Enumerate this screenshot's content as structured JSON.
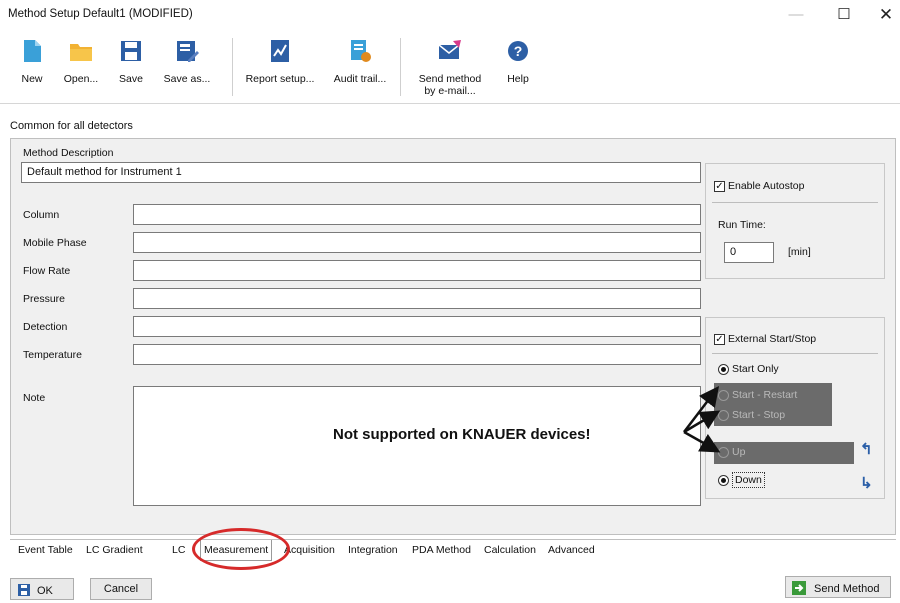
{
  "window": {
    "title": "Method Setup Default1 (MODIFIED)"
  },
  "toolbar": {
    "buttons": [
      {
        "label": "New",
        "icon": "new-file-icon"
      },
      {
        "label": "Open...",
        "icon": "folder-icon"
      },
      {
        "label": "Save",
        "icon": "floppy-disk-icon"
      },
      {
        "label": "Save as...",
        "icon": "save-as-icon"
      },
      {
        "label": "Report setup...",
        "icon": "report-chart-icon"
      },
      {
        "label": "Audit trail...",
        "icon": "audit-trail-icon"
      },
      {
        "label": "Send method by e-mail...",
        "icon": "email-send-icon"
      },
      {
        "label": "Help",
        "icon": "help-circle-icon"
      }
    ]
  },
  "section": {
    "title": "Common for all detectors"
  },
  "form": {
    "method_description_label": "Method Description",
    "method_description_value": "Default method for Instrument 1",
    "fields": [
      {
        "label": "Column",
        "value": ""
      },
      {
        "label": "Mobile Phase",
        "value": ""
      },
      {
        "label": "Flow Rate",
        "value": ""
      },
      {
        "label": "Pressure",
        "value": ""
      },
      {
        "label": "Detection",
        "value": ""
      },
      {
        "label": "Temperature",
        "value": ""
      }
    ],
    "note_label": "Note"
  },
  "autostop": {
    "enable_label": "Enable Autostop",
    "checked": true,
    "run_time_label": "Run Time:",
    "run_time_value": "0",
    "unit": "[min]"
  },
  "external": {
    "label": "External Start/Stop",
    "checked": true,
    "start_only": "Start Only",
    "start_restart": "Start - Restart",
    "start_stop": "Start - Stop",
    "up": "Up",
    "down": "Down"
  },
  "callout": {
    "text": "Not supported on KNAUER devices!"
  },
  "tabs": [
    {
      "label": "Event Table",
      "active": false
    },
    {
      "label": "LC Gradient",
      "active": false
    },
    {
      "label": "LC",
      "active": false
    },
    {
      "label": "Measurement",
      "active": true
    },
    {
      "label": "Acquisition",
      "active": false
    },
    {
      "label": "Integration",
      "active": false
    },
    {
      "label": "PDA Method",
      "active": false
    },
    {
      "label": "Calculation",
      "active": false
    },
    {
      "label": "Advanced",
      "active": false
    }
  ],
  "buttons": {
    "ok": "OK",
    "cancel": "Cancel",
    "send_method": "Send Method"
  },
  "colors": {
    "annotation_red": "#d62a2a",
    "icon_blue": "#2b5fa8",
    "send_green": "#3a9a3a"
  }
}
